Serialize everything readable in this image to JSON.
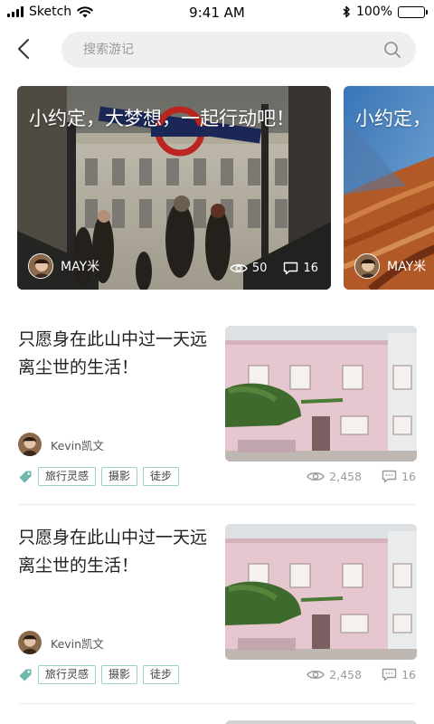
{
  "status_bar": {
    "carrier": "Sketch",
    "time": "9:41 AM",
    "battery_percent": "100%",
    "battery_level": 1.0
  },
  "header": {
    "back_icon": "chevron-left-icon",
    "search_placeholder": "搜索游记",
    "search_value": "",
    "search_icon": "search-icon"
  },
  "banners": [
    {
      "title": "小约定，大梦想，一起行动吧！",
      "author": "MAY米",
      "views": "50",
      "comments": "16",
      "image": "london-underground-photo"
    },
    {
      "title": "小约定，",
      "author": "MAY米",
      "image": "canyon-rock-photo"
    }
  ],
  "articles": [
    {
      "title": "只愿身在此山中过一天远离尘世的生活！",
      "author": "Kevin凯文",
      "tags": [
        "旅行灵感",
        "摄影",
        "徒步"
      ],
      "views": "2,458",
      "comments": "16",
      "image": "pink-house-photo"
    },
    {
      "title": "只愿身在此山中过一天远离尘世的生活！",
      "author": "Kevin凯文",
      "tags": [
        "旅行灵感",
        "摄影",
        "徒步"
      ],
      "views": "2,458",
      "comments": "16",
      "image": "pink-house-photo"
    }
  ],
  "colors": {
    "tag_border": "#9bcfc9",
    "tag_icon": "#6fb6ad",
    "search_bg": "#efefef",
    "muted_text": "#9b9b9b"
  }
}
